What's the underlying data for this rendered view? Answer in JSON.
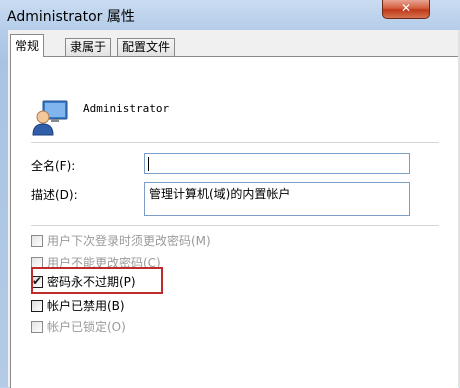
{
  "window": {
    "title": "Administrator 属性",
    "close_label": "✕"
  },
  "tabs": [
    {
      "label": "常规",
      "active": true
    },
    {
      "label": "隶属于",
      "active": false
    },
    {
      "label": "配置文件",
      "active": false
    }
  ],
  "user": {
    "name": "Administrator",
    "icon": "user-icon"
  },
  "fields": {
    "fullname_label": "全名(F):",
    "fullname_value": "",
    "description_label": "描述(D):",
    "description_value": "管理计算机(域)的内置帐户"
  },
  "options": [
    {
      "label": "用户下次登录时须更改密码(M)",
      "checked": false,
      "enabled": false
    },
    {
      "label": "用户不能更改密码(C)",
      "checked": false,
      "enabled": false
    },
    {
      "label": "密码永不过期(P)",
      "checked": true,
      "enabled": true
    },
    {
      "label": "帐户已禁用(B)",
      "checked": false,
      "enabled": true
    },
    {
      "label": "帐户已锁定(O)",
      "checked": false,
      "enabled": false
    }
  ],
  "colors": {
    "highlight_border": "#c02b2b",
    "input_border": "#7a9ec7"
  }
}
